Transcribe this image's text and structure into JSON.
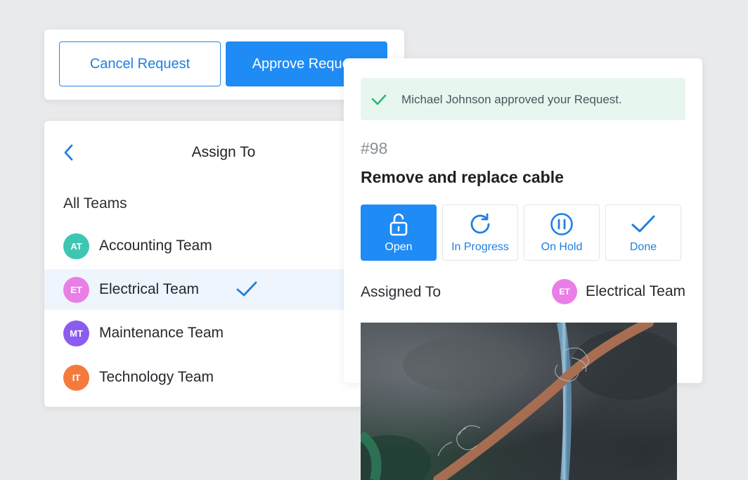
{
  "actions": {
    "cancel_label": "Cancel Request",
    "approve_label": "Approve Request"
  },
  "assign": {
    "title": "Assign To",
    "all_teams_label": "All Teams",
    "teams": [
      {
        "initials": "AT",
        "name": "Accounting Team",
        "color": "#3ec6b3",
        "selected": false
      },
      {
        "initials": "ET",
        "name": "Electrical Team",
        "color": "#e97fe6",
        "selected": true
      },
      {
        "initials": "MT",
        "name": "Maintenance Team",
        "color": "#8b5cf0",
        "selected": false
      },
      {
        "initials": "IT",
        "name": "Technology Team",
        "color": "#f57a3d",
        "selected": false
      }
    ]
  },
  "request": {
    "notice": "Michael Johnson approved your Request.",
    "id": "#98",
    "title": "Remove and replace cable",
    "statuses": [
      {
        "label": "Open",
        "icon": "unlock-icon",
        "active": true
      },
      {
        "label": "In Progress",
        "icon": "refresh-icon",
        "active": false
      },
      {
        "label": "On Hold",
        "icon": "pause-icon",
        "active": false
      },
      {
        "label": "Done",
        "icon": "check-icon",
        "active": false
      }
    ],
    "assigned_label": "Assigned To",
    "assigned_team": {
      "initials": "ET",
      "name": "Electrical Team",
      "color": "#e97fe6"
    }
  },
  "colors": {
    "accent": "#1f8bf5",
    "success_bg": "#e7f6ee",
    "success_icon": "#2eb673"
  }
}
